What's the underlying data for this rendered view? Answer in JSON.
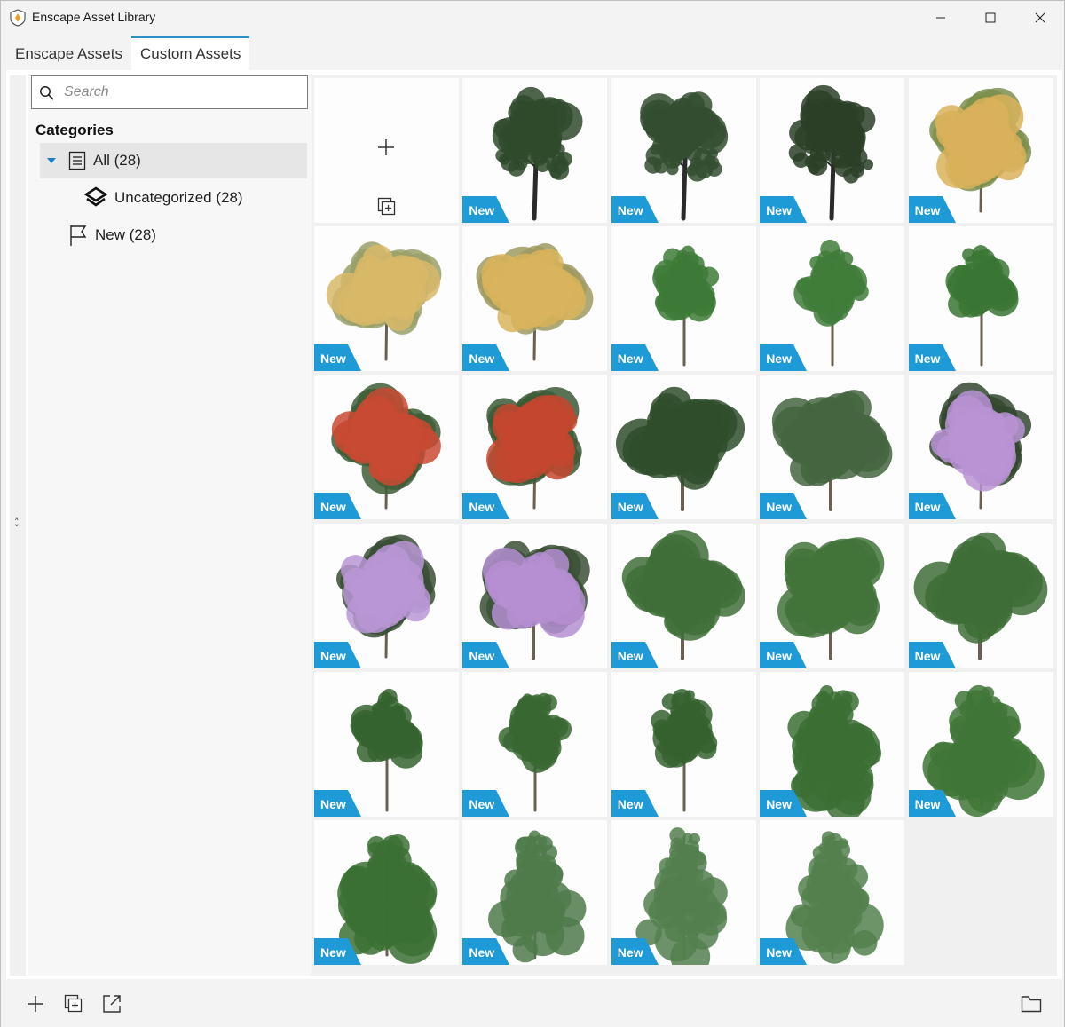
{
  "window": {
    "title": "Enscape Asset Library"
  },
  "tabs": [
    {
      "label": "Enscape Assets",
      "active": false
    },
    {
      "label": "Custom Assets",
      "active": true
    }
  ],
  "search": {
    "placeholder": "Search",
    "value": ""
  },
  "sidebar": {
    "categories_title": "Categories",
    "items": [
      {
        "label": "All (28)",
        "icon": "list-icon",
        "selected": true,
        "expanded": true
      },
      {
        "label": "Uncategorized (28)",
        "icon": "enscape-logo-icon",
        "selected": false
      },
      {
        "label": "New (28)",
        "icon": "flag-icon",
        "selected": false
      }
    ]
  },
  "grid": {
    "add_tile": {
      "icons": [
        "plus-icon",
        "duplicate-icon"
      ]
    },
    "badge_label": "New",
    "assets": [
      {
        "kind": "tall-dark",
        "foliage": "#2f4a2c",
        "flowers": null
      },
      {
        "kind": "tall-dark",
        "foliage": "#334d30",
        "flowers": null
      },
      {
        "kind": "tall-dark",
        "foliage": "#2a3f27",
        "flowers": null
      },
      {
        "kind": "round",
        "foliage": "#7c8f4d",
        "flowers": "#d9b25a"
      },
      {
        "kind": "round",
        "foliage": "#9aa06a",
        "flowers": "#d7b868"
      },
      {
        "kind": "round",
        "foliage": "#a09a62",
        "flowers": "#d9b45c"
      },
      {
        "kind": "slim",
        "foliage": "#3d7a37",
        "flowers": null
      },
      {
        "kind": "slim",
        "foliage": "#3f7c3a",
        "flowers": null
      },
      {
        "kind": "slim",
        "foliage": "#3a7534",
        "flowers": null
      },
      {
        "kind": "round",
        "foliage": "#3e5e37",
        "flowers": "#c94a32"
      },
      {
        "kind": "round",
        "foliage": "#3b5a35",
        "flowers": "#c4462f"
      },
      {
        "kind": "wide",
        "foliage": "#2f4d2c",
        "flowers": null
      },
      {
        "kind": "wide",
        "foliage": "#44653f",
        "flowers": null
      },
      {
        "kind": "round",
        "foliage": "#33482f",
        "flowers": "#b893d4"
      },
      {
        "kind": "round",
        "foliage": "#3a4d35",
        "flowers": "#b996d6"
      },
      {
        "kind": "wide",
        "foliage": "#3b5036",
        "flowers": "#b58fd2"
      },
      {
        "kind": "wide",
        "foliage": "#3f6e38",
        "flowers": null
      },
      {
        "kind": "wide",
        "foliage": "#427339",
        "flowers": null
      },
      {
        "kind": "wide",
        "foliage": "#3e6d37",
        "flowers": null
      },
      {
        "kind": "slim",
        "foliage": "#35632f",
        "flowers": null
      },
      {
        "kind": "slim",
        "foliage": "#386733",
        "flowers": null
      },
      {
        "kind": "slim",
        "foliage": "#35622f",
        "flowers": null
      },
      {
        "kind": "layered",
        "foliage": "#3b6e34",
        "flowers": null
      },
      {
        "kind": "layered",
        "foliage": "#3f7637",
        "flowers": null
      },
      {
        "kind": "layered",
        "foliage": "#3b7034",
        "flowers": null
      },
      {
        "kind": "pine",
        "foliage": "#4f7a4a",
        "flowers": null
      },
      {
        "kind": "pine",
        "foliage": "#547f4f",
        "flowers": null
      },
      {
        "kind": "pine",
        "foliage": "#53804e",
        "flowers": null
      }
    ]
  },
  "bottombar": {
    "icons": [
      "plus-icon",
      "duplicate-icon",
      "export-icon",
      "folder-icon"
    ]
  },
  "colors": {
    "accent": "#1e9bd7",
    "tab_indicator": "#2b8fc7",
    "selection": "#e6e6e6"
  }
}
